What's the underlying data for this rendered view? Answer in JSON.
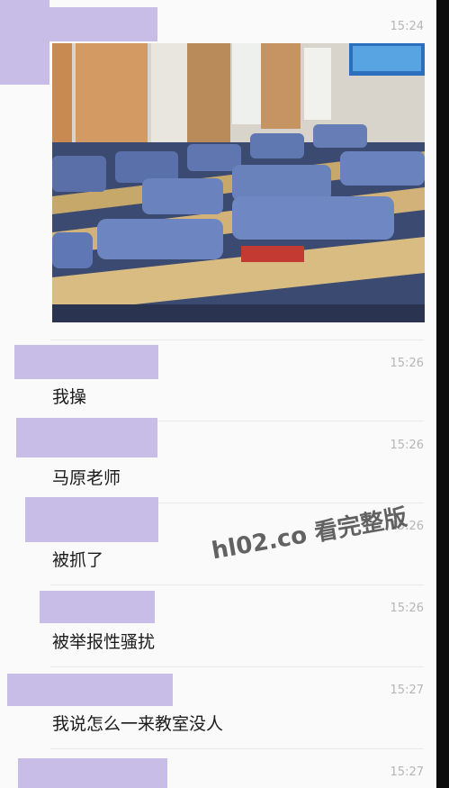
{
  "messages": [
    {
      "time": "15:24",
      "image": "classroom-photo"
    },
    {
      "time": "15:26",
      "text": "我操"
    },
    {
      "time": "15:26",
      "text": "马原老师"
    },
    {
      "time": "15:26",
      "text": "被抓了"
    },
    {
      "time": "15:26",
      "text": "被举报性骚扰"
    },
    {
      "time": "15:27",
      "text": "我说怎么一来教室没人"
    },
    {
      "time": "15:27"
    }
  ],
  "watermark": "hl02.co 看完整版",
  "colors": {
    "redaction": "#c7bde6",
    "background": "#fafafa",
    "timestamp": "#b6b6b6"
  }
}
